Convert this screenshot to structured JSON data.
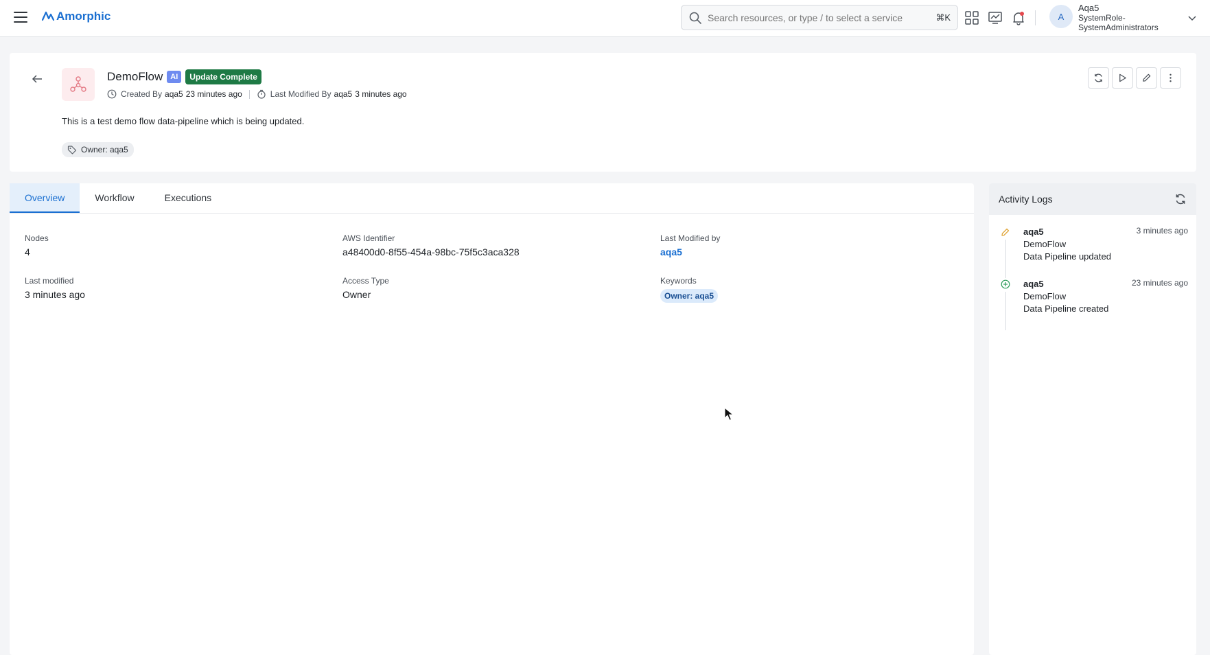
{
  "app": {
    "logo_text": "Amorphic"
  },
  "search": {
    "placeholder": "Search resources, or type / to select a service",
    "shortcut": "⌘K"
  },
  "user": {
    "avatar_letter": "A",
    "name": "Aqa5",
    "role_line1": "SystemRole-",
    "role_line2": "SystemAdministrators"
  },
  "header": {
    "title": "DemoFlow",
    "ai_badge": "AI",
    "status": "Update Complete",
    "created_label": "Created By",
    "created_by": "aqa5",
    "created_when": "23 minutes ago",
    "modified_label": "Last Modified By",
    "modified_by": "aqa5",
    "modified_when": "3 minutes ago",
    "description": "This is a test demo flow data-pipeline which is being updated.",
    "tag": "Owner: aqa5"
  },
  "tabs": [
    {
      "label": "Overview",
      "active": true
    },
    {
      "label": "Workflow",
      "active": false
    },
    {
      "label": "Executions",
      "active": false
    }
  ],
  "overview": {
    "nodes_label": "Nodes",
    "nodes_value": "4",
    "aws_label": "AWS Identifier",
    "aws_value": "a48400d0-8f55-454a-98bc-75f5c3aca328",
    "lastmodby_label": "Last Modified by",
    "lastmodby_value": "aqa5",
    "lastmod_label": "Last modified",
    "lastmod_value": "3 minutes ago",
    "access_label": "Access Type",
    "access_value": "Owner",
    "keywords_label": "Keywords",
    "keyword_chip": "Owner: aqa5"
  },
  "activity": {
    "title": "Activity Logs",
    "logs": [
      {
        "user": "aqa5",
        "resource": "DemoFlow",
        "action": "Data Pipeline updated",
        "time": "3 minutes ago",
        "icon": "pencil-icon"
      },
      {
        "user": "aqa5",
        "resource": "DemoFlow",
        "action": "Data Pipeline created",
        "time": "23 minutes ago",
        "icon": "plus-circle-icon"
      }
    ]
  },
  "colors": {
    "accent": "#1a6fd1",
    "status_green": "#1e7a45",
    "ai_badge": "#6e8bf0"
  }
}
